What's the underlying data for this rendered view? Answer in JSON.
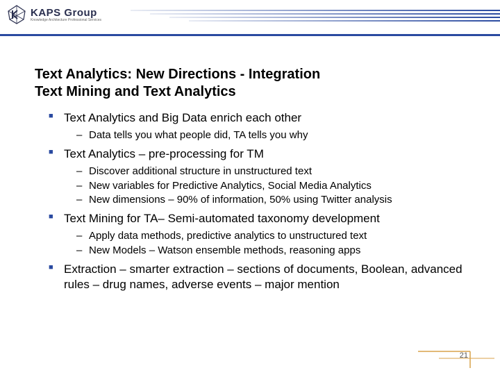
{
  "logo": {
    "main": "KAPS Group",
    "sub": "Knowledge Architecture Professional Services"
  },
  "title_line1": "Text Analytics: New Directions - Integration",
  "title_line2": " Text Mining and Text Analytics",
  "bullets": [
    {
      "text": "Text Analytics and Big Data enrich each other",
      "sub": [
        "Data tells you what people did, TA tells you why"
      ]
    },
    {
      "text": "Text Analytics – pre-processing for TM",
      "sub": [
        "Discover additional structure in unstructured text",
        "New variables for Predictive Analytics, Social Media Analytics",
        "New dimensions – 90% of information, 50% using Twitter analysis"
      ]
    },
    {
      "text": "Text Mining for TA– Semi-automated taxonomy development",
      "sub": [
        "Apply data methods, predictive analytics to unstructured text",
        "New Models – Watson ensemble methods, reasoning apps"
      ]
    },
    {
      "text": "Extraction – smarter extraction – sections of documents, Boolean, advanced rules – drug names, adverse events – major mention",
      "sub": []
    }
  ],
  "page_number": "21"
}
